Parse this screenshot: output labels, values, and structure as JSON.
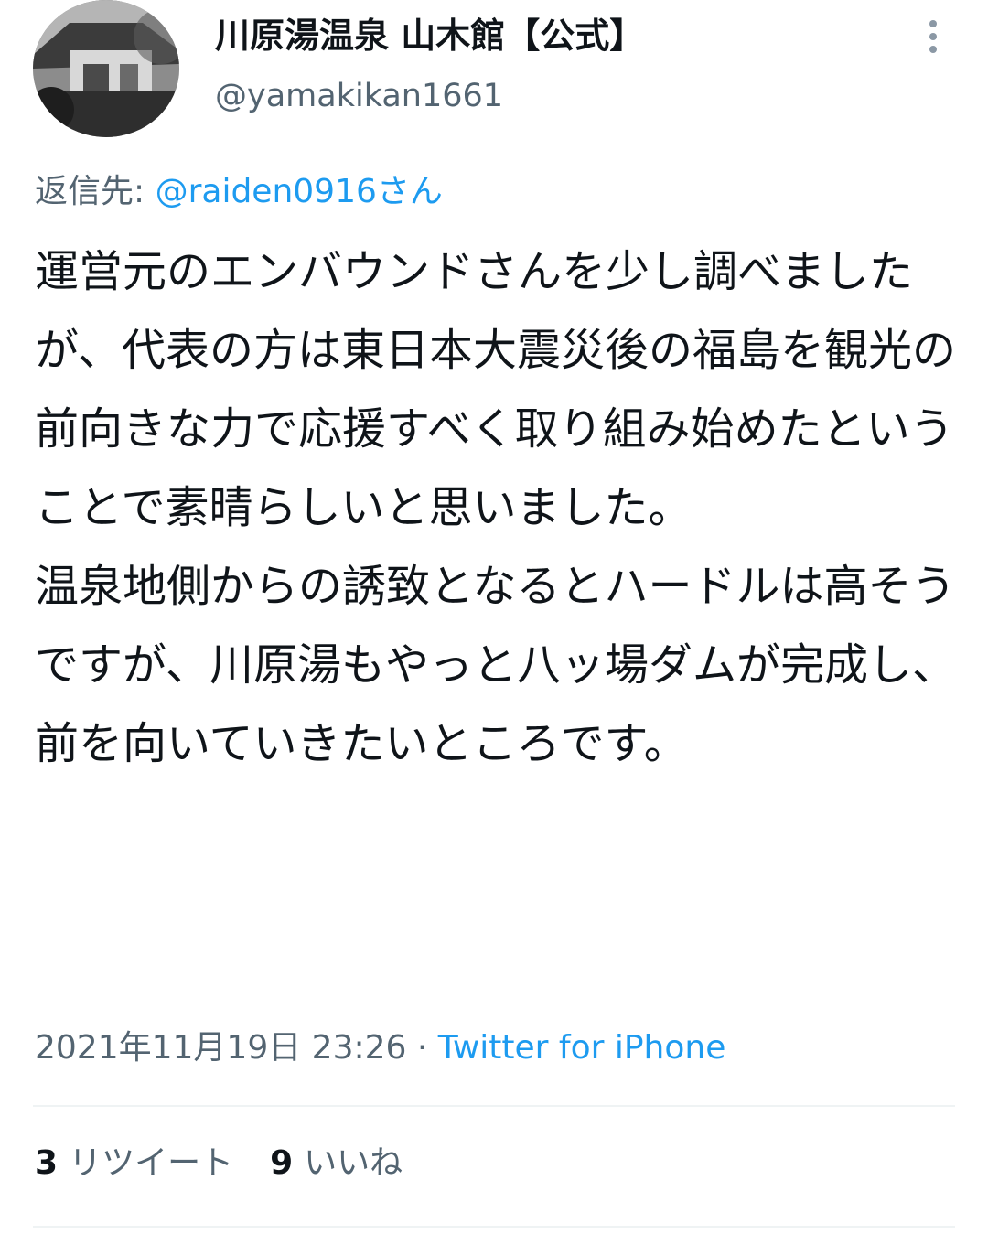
{
  "header": {
    "display_name": "川原湯温泉 山木館【公式】",
    "handle": "@yamakikan1661",
    "avatar_icon": "building-photo-avatar",
    "more_icon": "more-vertical-icon"
  },
  "tweet": {
    "reply_label": "返信先:",
    "reply_mention": "@raiden0916さん",
    "text": "運営元のエンバウンドさんを少し調べましたが、代表の方は東日本大震災後の福島を観光の前向きな力で応援すべく取り組み始めたということで素晴らしいと思いました。\n温泉地側からの誘致となるとハードルは高そうですが、川原湯もやっと八ッ場ダムが完成し、前を向いていきたいところです。",
    "timestamp": "2021年11月19日 23:26",
    "separator": "·",
    "source": "Twitter for iPhone"
  },
  "stats": {
    "retweets_count": "3",
    "retweets_label": "リツイート",
    "likes_count": "9",
    "likes_label": "いいね"
  },
  "colors": {
    "text_primary": "#0f1419",
    "text_secondary": "#536471",
    "accent_blue": "#1d9bf0",
    "divider": "#eff3f4"
  }
}
